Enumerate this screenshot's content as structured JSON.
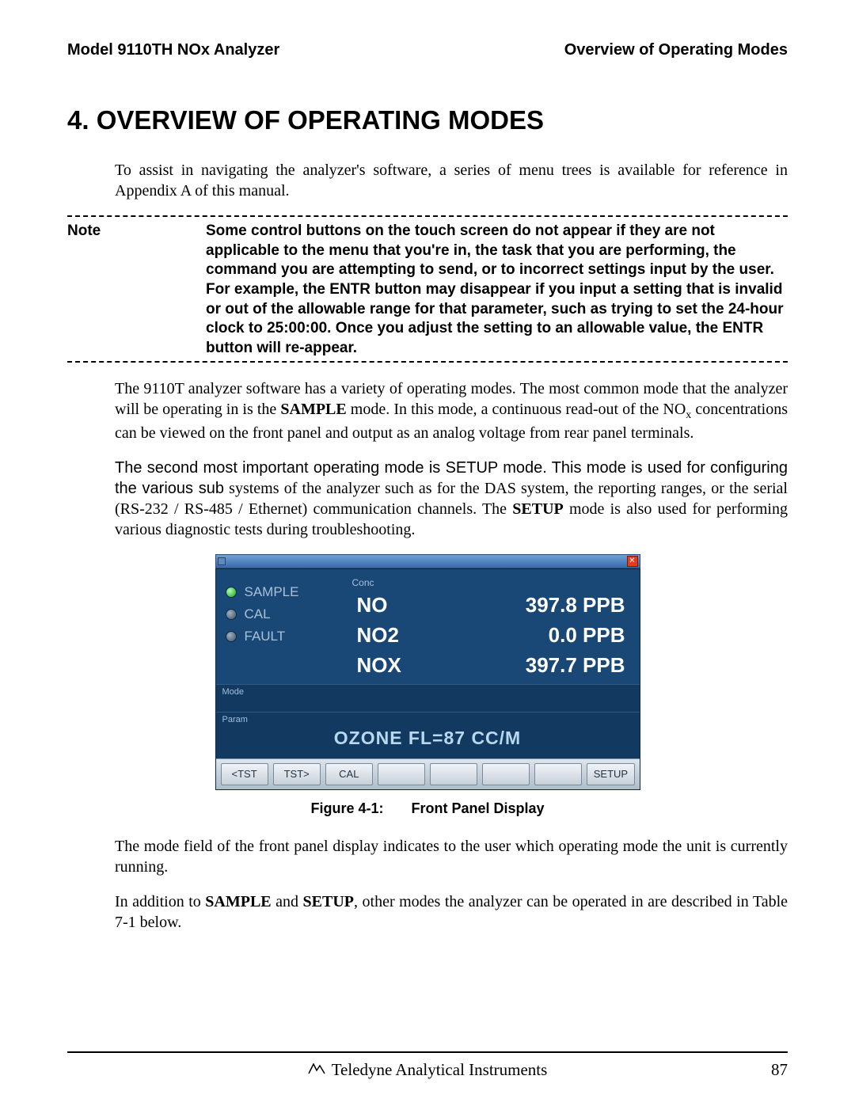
{
  "header": {
    "left": "Model 9110TH NOx Analyzer",
    "right": "Overview of Operating Modes"
  },
  "chapter_title": "4. OVERVIEW OF OPERATING MODES",
  "intro": "To assist in navigating the analyzer's software, a series of menu trees is available for reference in Appendix A of this manual.",
  "note": {
    "label": "Note",
    "body": "Some control buttons on the touch screen do not appear if they are not applicable to the menu that you're in, the task that you are performing, the command you are attempting to send, or to incorrect settings input by the user. For example, the ENTR button may disappear if you input a setting that is invalid or out of the allowable range for that parameter, such as trying to set the 24-hour clock to 25:00:00.  Once you adjust the setting to an allowable value, the ENTR button will re-appear."
  },
  "para1_a": "The 9110T analyzer software has a variety of operating modes.  The most common mode that the analyzer will be operating in is the ",
  "para1_bold": "SAMPLE",
  "para1_b": " mode.  In this mode, a continuous read-out of the NO",
  "para1_c": " concentrations can be viewed on the front panel and output as an analog voltage from rear panel terminals.",
  "para2_a": "The second most important operating mode is SETUP mode.  This mode is used for configuring the various sub",
  "para2_b": " systems of the analyzer such as for the DAS system, the reporting ranges, or the serial (RS-232 / RS-485 / Ethernet) communication channels.  The ",
  "para2_bold": "SETUP",
  "para2_c": " mode is also used for performing various diagnostic tests during troubleshooting.",
  "panel": {
    "status": [
      {
        "label": "SAMPLE",
        "led": "green"
      },
      {
        "label": "CAL",
        "led": "off"
      },
      {
        "label": "FAULT",
        "led": "off"
      }
    ],
    "conc_label": "Conc",
    "conc": [
      {
        "name": "NO",
        "value": "397.8 PPB"
      },
      {
        "name": "NO2",
        "value": "0.0 PPB"
      },
      {
        "name": "NOX",
        "value": "397.7 PPB"
      }
    ],
    "mode_label": "Mode",
    "param_label": "Param",
    "param_value": "OZONE FL=87 CC/M",
    "buttons": [
      "<TST",
      "TST>",
      "CAL",
      "",
      "",
      "",
      "",
      "SETUP"
    ]
  },
  "figure_caption": {
    "num": "Figure 4-1:",
    "title": "Front Panel Display"
  },
  "para3": "The mode field of the front panel display indicates to the user which operating mode the unit is currently running.",
  "para4_a": "In addition to ",
  "para4_b1": "SAMPLE",
  "para4_c": " and ",
  "para4_b2": "SETUP",
  "para4_d": ", other modes the analyzer can be operated in are described in Table 7-1 below.",
  "footer": {
    "company": "Teledyne Analytical Instruments",
    "page": "87"
  }
}
